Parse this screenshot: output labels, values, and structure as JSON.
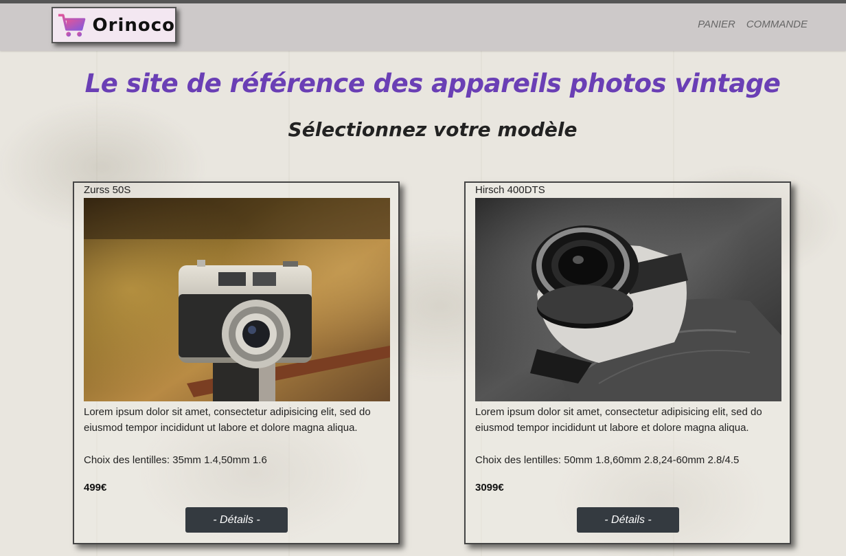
{
  "header": {
    "logo_text": "Orinoco",
    "nav": [
      {
        "label": "PANIER"
      },
      {
        "label": "COMMANDE"
      }
    ]
  },
  "main": {
    "headline": "Le site de référence des appareils photos vintage",
    "subhead": "Sélectionnez votre modèle",
    "products": [
      {
        "name": "Zurss 50S",
        "description": "Lorem ipsum dolor sit amet, consectetur adipisicing elit, sed do eiusmod tempor incididunt ut labore et dolore magna aliqua.",
        "lenses": "Choix des lentilles: 35mm 1.4,50mm 1.6",
        "price": "499€",
        "button_label": "- Détails -"
      },
      {
        "name": "Hirsch 400DTS",
        "description": "Lorem ipsum dolor sit amet, consectetur adipisicing elit, sed do eiusmod tempor incididunt ut labore et dolore magna aliqua.",
        "lenses": "Choix des lentilles: 50mm 1.8,60mm 2.8,24-60mm 2.8/4.5",
        "price": "3099€",
        "button_label": "- Détails -"
      }
    ]
  },
  "colors": {
    "headline": "#6a3fb5",
    "header_bg": "#cdc9c9",
    "button_bg": "#343a40"
  }
}
